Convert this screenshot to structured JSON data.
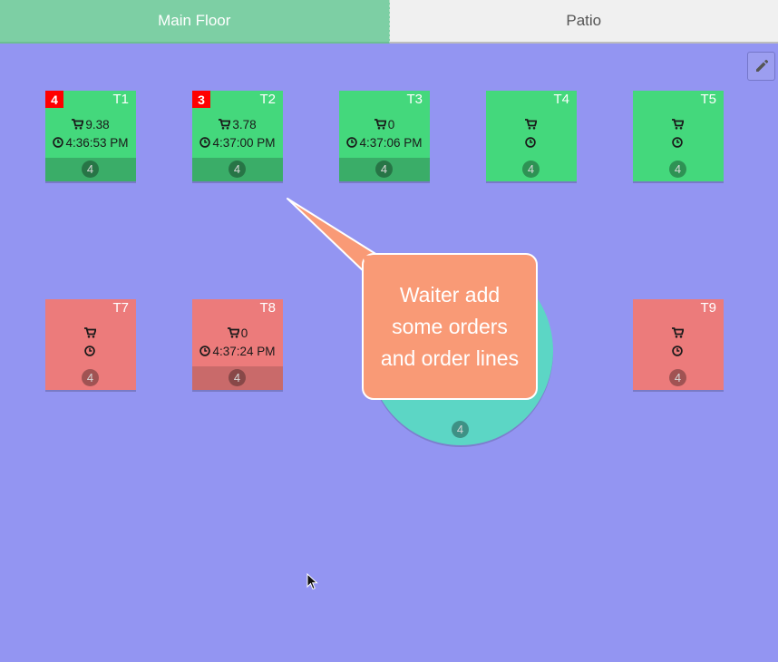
{
  "tabs": [
    {
      "label": "Main Floor",
      "active": true
    },
    {
      "label": "Patio",
      "active": false
    }
  ],
  "edit_icon": "pencil-icon",
  "tables": {
    "t1": {
      "name": "T1",
      "badge": "4",
      "amount": "9.38",
      "time": "4:36:53 PM",
      "seats": "4",
      "status": "free"
    },
    "t2": {
      "name": "T2",
      "badge": "3",
      "amount": "3.78",
      "time": "4:37:00 PM",
      "seats": "4",
      "status": "free"
    },
    "t3": {
      "name": "T3",
      "amount": "0",
      "time": "4:37:06 PM",
      "seats": "4",
      "status": "free"
    },
    "t4": {
      "name": "T4",
      "amount": "",
      "time": "",
      "seats": "4",
      "status": "free"
    },
    "t5": {
      "name": "T5",
      "amount": "",
      "time": "",
      "seats": "4",
      "status": "free"
    },
    "t7": {
      "name": "T7",
      "amount": "",
      "time": "",
      "seats": "4",
      "status": "occupied"
    },
    "t8": {
      "name": "T8",
      "amount": "0",
      "time": "4:37:24 PM",
      "seats": "4",
      "status": "occupied"
    },
    "t9": {
      "name": "T9",
      "amount": "",
      "time": "",
      "seats": "4",
      "status": "occupied"
    },
    "round": {
      "seats": "4"
    }
  },
  "callout": {
    "text": "Waiter add some orders and order lines"
  },
  "colors": {
    "floor_bg": "#9395f2",
    "free_table": "#44d87c",
    "occupied_table": "#ec7b7b",
    "round_table": "#5cd6c5",
    "callout_bg": "#f99a76",
    "badge": "#ff0000",
    "active_tab": "#7dcfa4"
  }
}
